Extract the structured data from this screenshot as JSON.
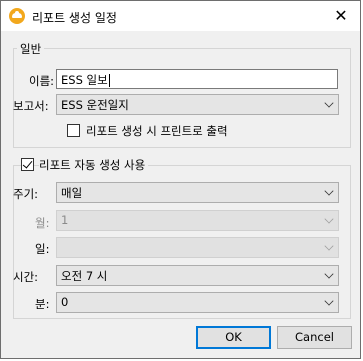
{
  "window": {
    "title": "리포트 생성 일정",
    "close_glyph": "✕"
  },
  "general": {
    "group_title": "일반",
    "name_label": "이름:",
    "name_value": "ESS 일보",
    "report_label": "보고서:",
    "report_value": "ESS 운전일지",
    "print_checkbox_label": "리포트 생성 시 프린트로 출력",
    "print_checked": false
  },
  "auto": {
    "checkbox_label": "리포트 자동 생성 사용",
    "checked": true,
    "period_label": "주기:",
    "period_value": "매일",
    "month_label": "월:",
    "month_value": "1",
    "day_label": "일:",
    "day_value": "",
    "time_label": "시간:",
    "time_value": "오전 7 시",
    "minute_label": "분:",
    "minute_value": "0"
  },
  "buttons": {
    "ok": "OK",
    "cancel": "Cancel"
  }
}
